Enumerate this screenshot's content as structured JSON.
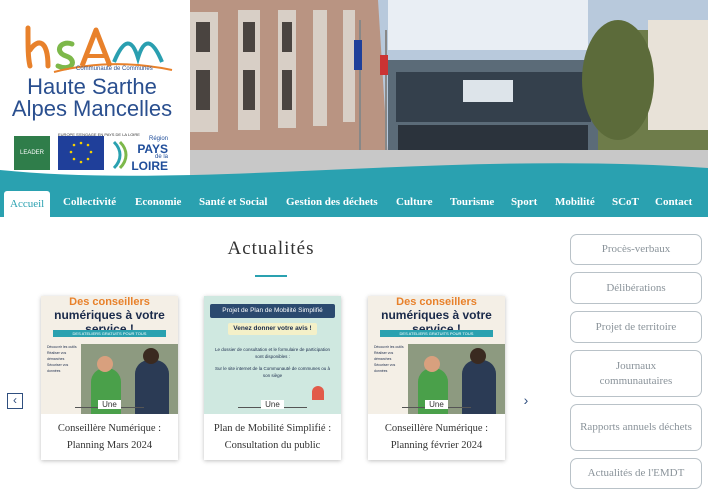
{
  "logo": {
    "mark": "hsAm",
    "subtitle": "Communauté de Communes",
    "title_line1": "Haute Sarthe",
    "title_line2": "Alpes Mancelles"
  },
  "partners": {
    "leader_label": "LEADER",
    "eu_caption": "EUROPE S'ENGAGE EN PAYS DE LA LOIRE",
    "region_prefix": "Région",
    "region_name_1": "PAYS",
    "region_de": "de la",
    "region_name_2": "LOIRE"
  },
  "nav": {
    "items": [
      {
        "label": "Accueil",
        "active": true
      },
      {
        "label": "Collectivité"
      },
      {
        "label": "Economie"
      },
      {
        "label": "Santé et Social"
      },
      {
        "label": "Gestion des déchets"
      },
      {
        "label": "Culture"
      },
      {
        "label": "Tourisme"
      },
      {
        "label": "Sport"
      },
      {
        "label": "Mobilité"
      },
      {
        "label": "SCoT"
      },
      {
        "label": "Contact"
      }
    ]
  },
  "main": {
    "title": "Actualités"
  },
  "carousel": {
    "prev_icon": "chevron-left-icon",
    "next_icon": "chevron-right-icon",
    "badge": "Une",
    "cards": [
      {
        "caption": "Conseillère Numérique : Planning Mars 2024",
        "thumb_line1": "Des conseillers",
        "thumb_line2": "numériques à votre service !",
        "thumb_bar": "DES ATELIERS GRATUITS POUR TOUS",
        "thumb_list": [
          "Découvrir les outils",
          "Réaliser vos démarches",
          "Sécuriser vos données"
        ]
      },
      {
        "caption": "Plan de Mobilité Simplifié : Consultation du public",
        "thumb_head": "Projet de Plan de Mobilité Simplifié",
        "thumb_sub": "Venez donner votre avis !",
        "thumb_text_1": "Le dossier de consultation et le formulaire de participation sont disponibles :",
        "thumb_text_2": "Sur le site internet de la Communauté de communes ou à son siège"
      },
      {
        "caption": "Conseillère Numérique : Planning février 2024",
        "thumb_line1": "Des conseillers",
        "thumb_line2": "numériques à votre service !",
        "thumb_bar": "DES ATELIERS GRATUITS POUR TOUS",
        "thumb_list": [
          "Découvrir les outils",
          "Réaliser vos démarches",
          "Sécuriser vos données"
        ]
      }
    ]
  },
  "sidebar": {
    "buttons": [
      {
        "label": "Procès-verbaux"
      },
      {
        "label": "Délibérations"
      },
      {
        "label": "Projet de territoire"
      },
      {
        "label": "Journaux communautaires"
      },
      {
        "label": "Rapports annuels déchets"
      },
      {
        "label": "Actualités de l'EMDT"
      }
    ]
  },
  "colors": {
    "accent": "#2aa1b0",
    "logo_blue": "#2a4f8f",
    "logo_orange": "#e8812b",
    "logo_green": "#7db84a"
  }
}
